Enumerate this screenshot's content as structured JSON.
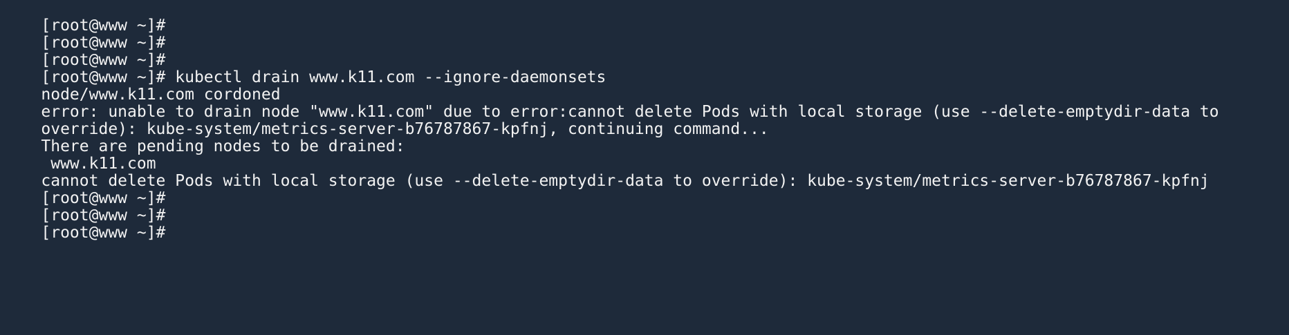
{
  "terminal": {
    "prompt": "[root@www ~]#",
    "lines": [
      {
        "type": "prompt",
        "command": ""
      },
      {
        "type": "prompt",
        "command": ""
      },
      {
        "type": "prompt",
        "command": ""
      },
      {
        "type": "prompt",
        "command": " kubectl drain www.k11.com --ignore-daemonsets"
      },
      {
        "type": "output",
        "text": "node/www.k11.com cordoned"
      },
      {
        "type": "output",
        "text": "error: unable to drain node \"www.k11.com\" due to error:cannot delete Pods with local storage (use --delete-emptydir-data to"
      },
      {
        "type": "output",
        "text": "override): kube-system/metrics-server-b76787867-kpfnj, continuing command..."
      },
      {
        "type": "output",
        "text": "There are pending nodes to be drained:"
      },
      {
        "type": "output",
        "text": " www.k11.com"
      },
      {
        "type": "output",
        "text": "cannot delete Pods with local storage (use --delete-emptydir-data to override): kube-system/metrics-server-b76787867-kpfnj"
      },
      {
        "type": "prompt",
        "command": ""
      },
      {
        "type": "prompt",
        "command": ""
      },
      {
        "type": "prompt",
        "command": ""
      }
    ]
  },
  "colors": {
    "background": "#1e2a3a",
    "foreground": "#f2f2f2"
  }
}
